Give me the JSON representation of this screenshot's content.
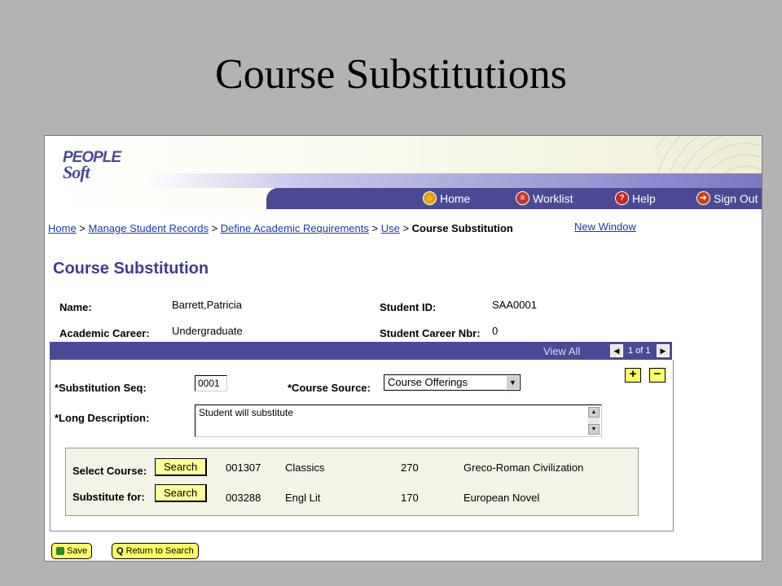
{
  "slide_title": "Course Substitutions",
  "logo": {
    "line1": "PEOPLE",
    "line2": "Soft"
  },
  "nav": {
    "home": "Home",
    "worklist": "Worklist",
    "help": "Help",
    "signout": "Sign Out"
  },
  "breadcrumb": {
    "items": [
      "Home",
      "Manage Student Records",
      "Define Academic Requirements",
      "Use"
    ],
    "current": "Course Substitution",
    "new_window": "New Window"
  },
  "page_title": "Course Substitution",
  "header_fields": {
    "name_label": "Name:",
    "name_value": "Barrett,Patricia",
    "career_label": "Academic Career:",
    "career_value": "Undergraduate",
    "id_label": "Student ID:",
    "id_value": "SAA0001",
    "career_nbr_label": "Student Career Nbr:",
    "career_nbr_value": "0"
  },
  "grid": {
    "view_all": "View All",
    "count": "1 of 1"
  },
  "form": {
    "seq_label": "*Substitution Seq:",
    "seq_value": "0001",
    "source_label": "*Course Source:",
    "source_value": "Course Offerings",
    "desc_label": "*Long Description:",
    "desc_value": "Student will substitute"
  },
  "courses": {
    "search_label": "Search",
    "rows": [
      {
        "label": "Select Course:",
        "id": "001307",
        "subject": "Classics",
        "number": "270",
        "title": "Greco-Roman Civilization"
      },
      {
        "label": "Substitute for:",
        "id": "003288",
        "subject": "Engl Lit",
        "number": "170",
        "title": "European Novel"
      }
    ]
  },
  "footer": {
    "save": "Save",
    "return": "Return to Search"
  }
}
